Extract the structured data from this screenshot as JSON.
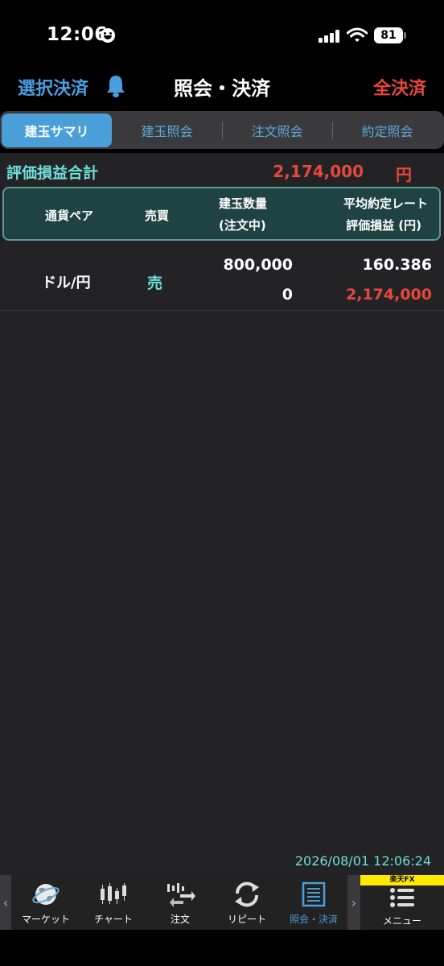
{
  "status_bar": {
    "time": "12:06",
    "battery": "81"
  },
  "nav": {
    "left_label": "選択決済",
    "title": "照会・決済",
    "right_label": "全決済"
  },
  "tabs": [
    {
      "label": "建玉サマリ",
      "active": true
    },
    {
      "label": "建玉照会",
      "active": false
    },
    {
      "label": "注文照会",
      "active": false
    },
    {
      "label": "約定照会",
      "active": false
    }
  ],
  "summary": {
    "label": "評価損益合計",
    "value": "2,174,000",
    "unit": "円"
  },
  "table": {
    "headers": {
      "pair": "通貨ペア",
      "side": "売買",
      "qty_line1": "建玉数量",
      "qty_line2": "(注文中)",
      "rate_line1": "平均約定レート",
      "rate_line2": "評価損益 (円)"
    },
    "rows": [
      {
        "pair": "ドル/円",
        "side": "売",
        "quantity": "800,000",
        "pending": "0",
        "rate": "160.386",
        "pnl": "2,174,000"
      }
    ]
  },
  "timestamp": "2026/08/01 12:06:24",
  "bottom_nav": {
    "items": [
      {
        "label": "マーケット",
        "icon": "globe-icon"
      },
      {
        "label": "チャート",
        "icon": "candlestick-chart-icon"
      },
      {
        "label": "注文",
        "icon": "order-icon"
      },
      {
        "label": "リピート",
        "icon": "repeat-icon"
      },
      {
        "label": "照会・決済",
        "icon": "document-list-icon",
        "active": true
      }
    ],
    "menu": {
      "label": "メニュー",
      "badge": "楽天FX",
      "icon": "menu-list-icon"
    }
  },
  "colors": {
    "accent_blue": "#4a9fd8",
    "loss_red": "#e8473e",
    "teal": "#6ee0d8"
  }
}
